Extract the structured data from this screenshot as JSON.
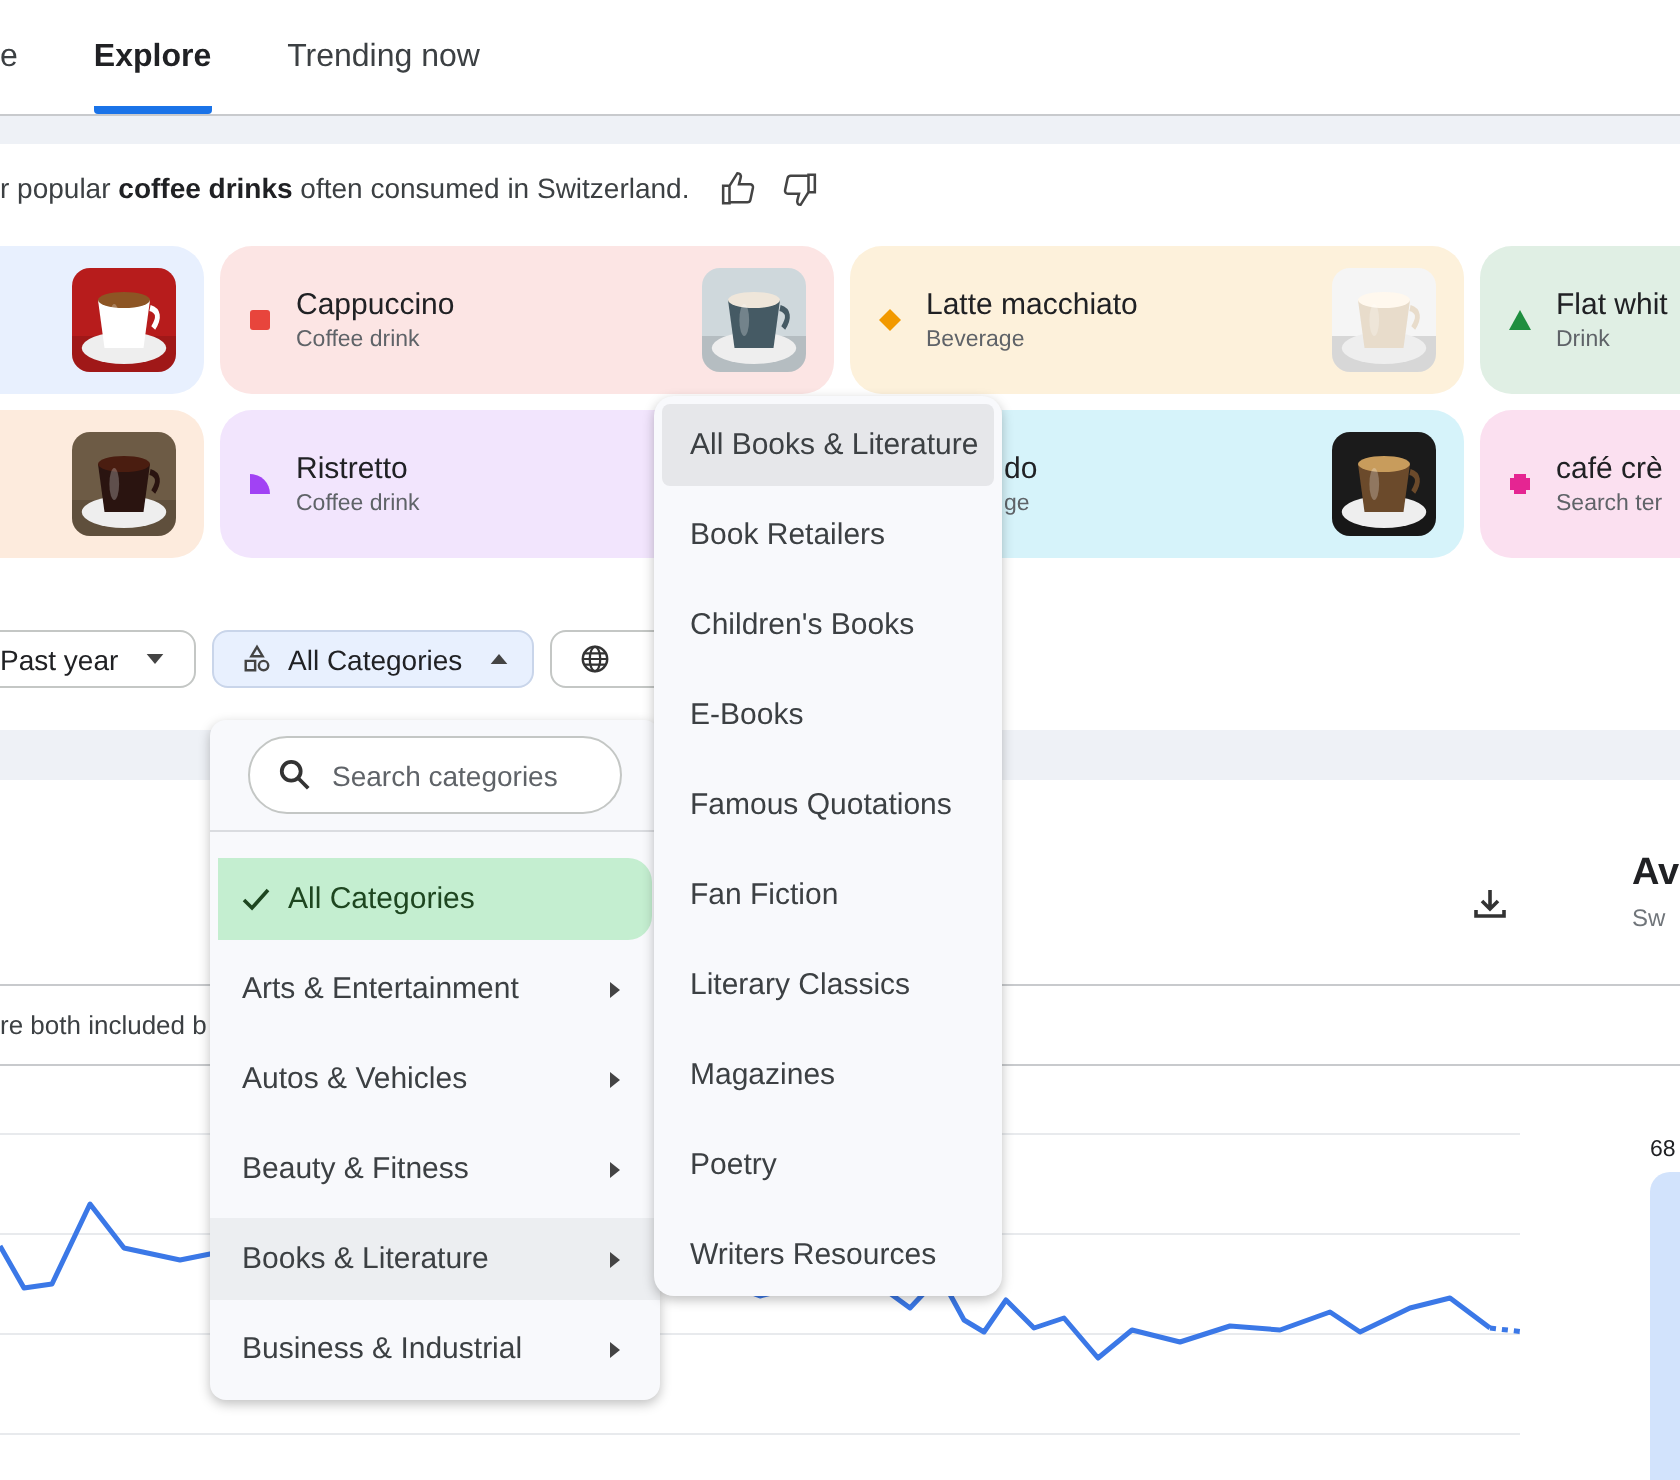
{
  "tabs": [
    {
      "label": "e",
      "selected": false
    },
    {
      "label": "Explore",
      "selected": true
    },
    {
      "label": "Trending now",
      "selected": false
    }
  ],
  "summary": {
    "text": "r popular **coffee drinks** often consumed in Switzerland."
  },
  "card_rows": [
    [
      {
        "kind": "none",
        "color": "#e8f0fe",
        "picture": true
      },
      {
        "kind": "square",
        "color": "#e8453c",
        "title": "Cappuccino",
        "subtitle": "Coffee drink",
        "picture": true
      },
      {
        "kind": "diamond",
        "color": "#f29900",
        "title": "Latte macchiato",
        "subtitle": "Beverage",
        "picture": true
      },
      {
        "kind": "triangle",
        "color": "#1e8e3e",
        "title": "Flat whit",
        "subtitle": "Drink"
      }
    ],
    [
      {
        "kind": "none",
        "color": "#fdebdd",
        "picture": true
      },
      {
        "kind": "quarter",
        "color": "#a142f4",
        "title": "Ristretto",
        "subtitle": "Coffee drink"
      },
      {
        "kind": "none",
        "color": "#d6f3fa",
        "title": "do",
        "subtitle": "ge",
        "picture": true
      },
      {
        "kind": "cross",
        "color": "#e52592",
        "title": "café crè",
        "subtitle": "Search ter"
      }
    ]
  ],
  "filters": [
    {
      "kind": "plain",
      "label": "Past year",
      "open": false
    },
    {
      "kind": "categories",
      "label": "All Categories",
      "open": true
    },
    {
      "kind": "globe",
      "open": false
    }
  ],
  "panel": {
    "heading": "Av",
    "subheading": "Sw",
    "note": "re both included b",
    "bar_label": "68"
  },
  "category_menu": {
    "placeholder": "Search categories",
    "items": [
      {
        "label": "All Categories",
        "selected": true,
        "highlighted": false,
        "submenu": false
      },
      {
        "label": "Arts & Entertainment",
        "selected": false,
        "highlighted": false,
        "submenu": true
      },
      {
        "label": "Autos & Vehicles",
        "selected": false,
        "highlighted": false,
        "submenu": true
      },
      {
        "label": "Beauty & Fitness",
        "selected": false,
        "highlighted": false,
        "submenu": true
      },
      {
        "label": "Books & Literature",
        "selected": false,
        "highlighted": true,
        "submenu": true
      },
      {
        "label": "Business & Industrial",
        "selected": false,
        "highlighted": false,
        "submenu": true
      }
    ]
  },
  "submenu": {
    "items": [
      {
        "label": "All Books & Literature",
        "highlighted": true
      },
      {
        "label": "Book Retailers",
        "highlighted": false
      },
      {
        "label": "Children's Books",
        "highlighted": false
      },
      {
        "label": "E-Books",
        "highlighted": false
      },
      {
        "label": "Famous Quotations",
        "highlighted": false
      },
      {
        "label": "Fan Fiction",
        "highlighted": false
      },
      {
        "label": "Literary Classics",
        "highlighted": false
      },
      {
        "label": "Magazines",
        "highlighted": false
      },
      {
        "label": "Poetry",
        "highlighted": false
      },
      {
        "label": "Writers Resources",
        "highlighted": false
      }
    ]
  }
}
